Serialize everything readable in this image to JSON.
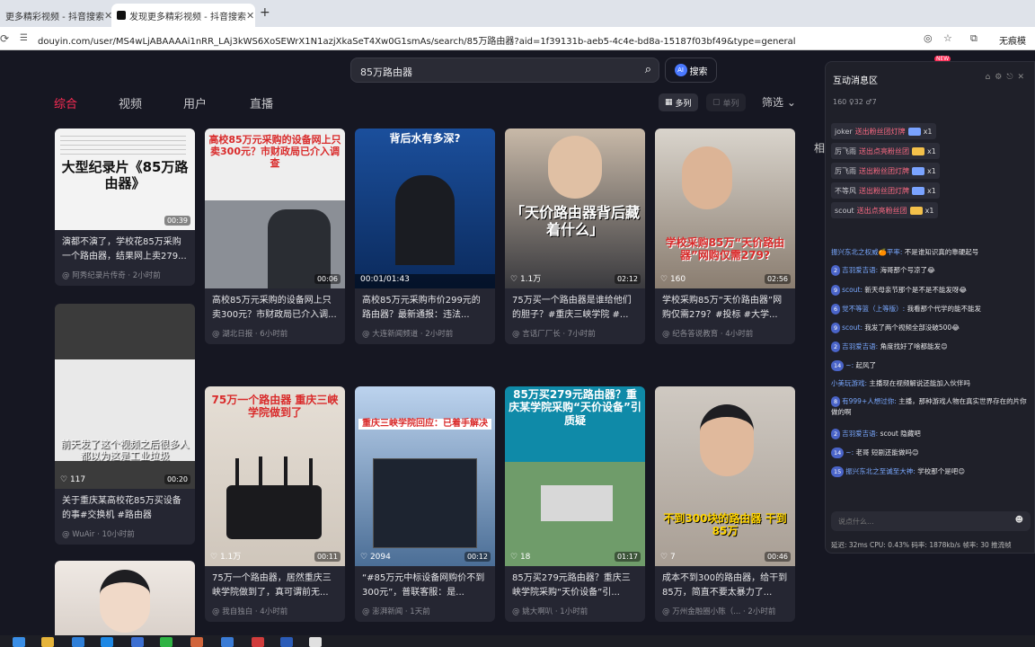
{
  "browser": {
    "tabs": [
      {
        "title": "更多精彩视频 - 抖音搜索"
      },
      {
        "title": "发现更多精彩视频 - 抖音搜索"
      }
    ],
    "url": "douyin.com/user/MS4wLjABAAAAi1nRR_LAj3kWS6XoSEWrX1N1azjXkaSeT4Xw0G1smAs/search/85万路由器?aid=1f39131b-aeb5-4c4e-bd8a-15187f03bf49&type=general",
    "profile_label": "无痕模"
  },
  "search": {
    "query": "85万路由器",
    "ai_label": "搜索"
  },
  "categories": [
    "综合",
    "视频",
    "用户",
    "直播"
  ],
  "view": {
    "multi": "多列",
    "single": "单列",
    "filter": "筛选"
  },
  "cards": [
    {
      "thumb_title": "大型纪录片《85万路由器》",
      "duration": "00:39",
      "desc": "演都不演了，学校花85万采购一个路由器，结果网上卖279...",
      "meta": "@ 阿秀纪录片传奇 · 2小时前"
    },
    {
      "thumb_title": "高校85万元采购的设备网上只卖300元？市财政局已介入调查",
      "duration": "00:06",
      "desc": "高校85万元采购的设备网上只卖300元？市财政局已介入调...",
      "meta": "@ 湖北日报 · 6小时前"
    },
    {
      "thumb_title": "背后水有多深?",
      "duration": "00:01/01:43",
      "desc": "高校85万元采购市价299元的路由器？最新通报：违法...",
      "meta": "@ 大连新闻频道 · 2小时前"
    },
    {
      "thumb_title": "「天价路由器背后藏着什么」",
      "likes": "1.1万",
      "duration": "02:12",
      "desc": "75万买一个路由器是谁给他们的胆子？#重庆三峡学院 #...",
      "meta": "@ 言话厂厂长 · 7小时前"
    },
    {
      "thumb_title": "学校采购85万“天价路由器”网购仅需279?",
      "likes": "160",
      "duration": "02:56",
      "desc": "学校采购85万“天价路由器”网购仅需279？#投标 #大学...",
      "meta": "@ 纪各答说教育 · 4小时前"
    },
    {
      "thumb_title": "前天发了这个视频之后很多人都以为这是工业垃圾",
      "likes": "117",
      "duration": "00:20",
      "desc": "关于重庆某高校花85万买设备的事#交换机 #路由器",
      "meta": "@ WuAir · 10小时前"
    },
    {
      "thumb_title": "75万一个路由器 重庆三峡学院做到了",
      "likes": "1.1万",
      "duration": "00:11",
      "desc": "75万一个路由器，居然重庆三峡学院做到了，真可谓前无...",
      "meta": "@ 我自独白 · 4小时前"
    },
    {
      "thumb_title": "重庆三峡学院回应：已着手解决",
      "likes": "2094",
      "duration": "00:12",
      "desc": "“#85万元中标设备网购价不到300元”，普联客服：是...",
      "meta": "@ 澎湃新闻 · 1天前"
    },
    {
      "thumb_title": "85万买279元路由器？重庆某学院采购“天价设备”引质疑",
      "likes": "18",
      "duration": "01:17",
      "desc": "85万买279元路由器？重庆三峡学院采购“天价设备”引...",
      "meta": "@ 姚大啊叭 · 1小时前"
    },
    {
      "thumb_title": "不到300块的路由器 干到85万",
      "likes": "7",
      "duration": "00:46",
      "desc": "成本不到300的路由器，给干到85万，简直不要太暴力了...",
      "meta": "@ 万州金融圈小陈（... · 2小时前"
    }
  ],
  "chat": {
    "title": "互动消息区",
    "stats": "160  ♀32  ♂7",
    "gifts": [
      {
        "user": "joker",
        "action": "送出粉丝团灯牌",
        "count": "x1"
      },
      {
        "user": "厉飞雨",
        "action": "送出点亮粉丝团",
        "count": "x1"
      },
      {
        "user": "厉飞雨",
        "action": "送出粉丝团灯牌",
        "count": "x1"
      },
      {
        "user": "不等风",
        "action": "送出粉丝团灯牌",
        "count": "x1"
      },
      {
        "user": "scout",
        "action": "送出点亮粉丝团",
        "count": "x1"
      }
    ],
    "messages": [
      {
        "level": "",
        "user": "振兴东北之权威🍊平率:",
        "text": "不是谁知识真的靠硬起号"
      },
      {
        "level": "2",
        "user": "吉羽爱吉语:",
        "text": "海哥那个号凉了😂"
      },
      {
        "level": "9",
        "user": "scout:",
        "text": "新天母亲节那个是不是不能发呀😂"
      },
      {
        "level": "6",
        "user": "觉不等篮（上等版）:",
        "text": "我看那个代学的能不能发"
      },
      {
        "level": "9",
        "user": "scout:",
        "text": "我发了两个视频全部没破500😂"
      },
      {
        "level": "2",
        "user": "吉羽爱吉语:",
        "text": "角度找好了啥都能发😊"
      },
      {
        "level": "14",
        "user": "~:",
        "text": "起风了"
      },
      {
        "level": "",
        "user": "小美玩游戏:",
        "text": "主播现在视频解说还能加入伙伴吗"
      },
      {
        "level": "8",
        "user": "有999+人想过你:",
        "text": "主播，那种游戏人物在真实世界存在的片你做的啊"
      },
      {
        "level": "2",
        "user": "吉羽爱吉语:",
        "text": "scout 隐藏吧"
      },
      {
        "level": "14",
        "user": "~:",
        "text": "老哥 短剧还能做吗😊"
      },
      {
        "level": "15",
        "user": "振兴东北之至诚至大神:",
        "text": "学校那个是吧😊"
      }
    ],
    "input_placeholder": "说点什么...",
    "status": "延迟: 32ms   CPU: 0.43%   码率: 1878kb/s   帧率: 30   推流帧"
  },
  "colors": {
    "accent": "#fe2c55",
    "background": "#161722",
    "card": "#252632"
  }
}
